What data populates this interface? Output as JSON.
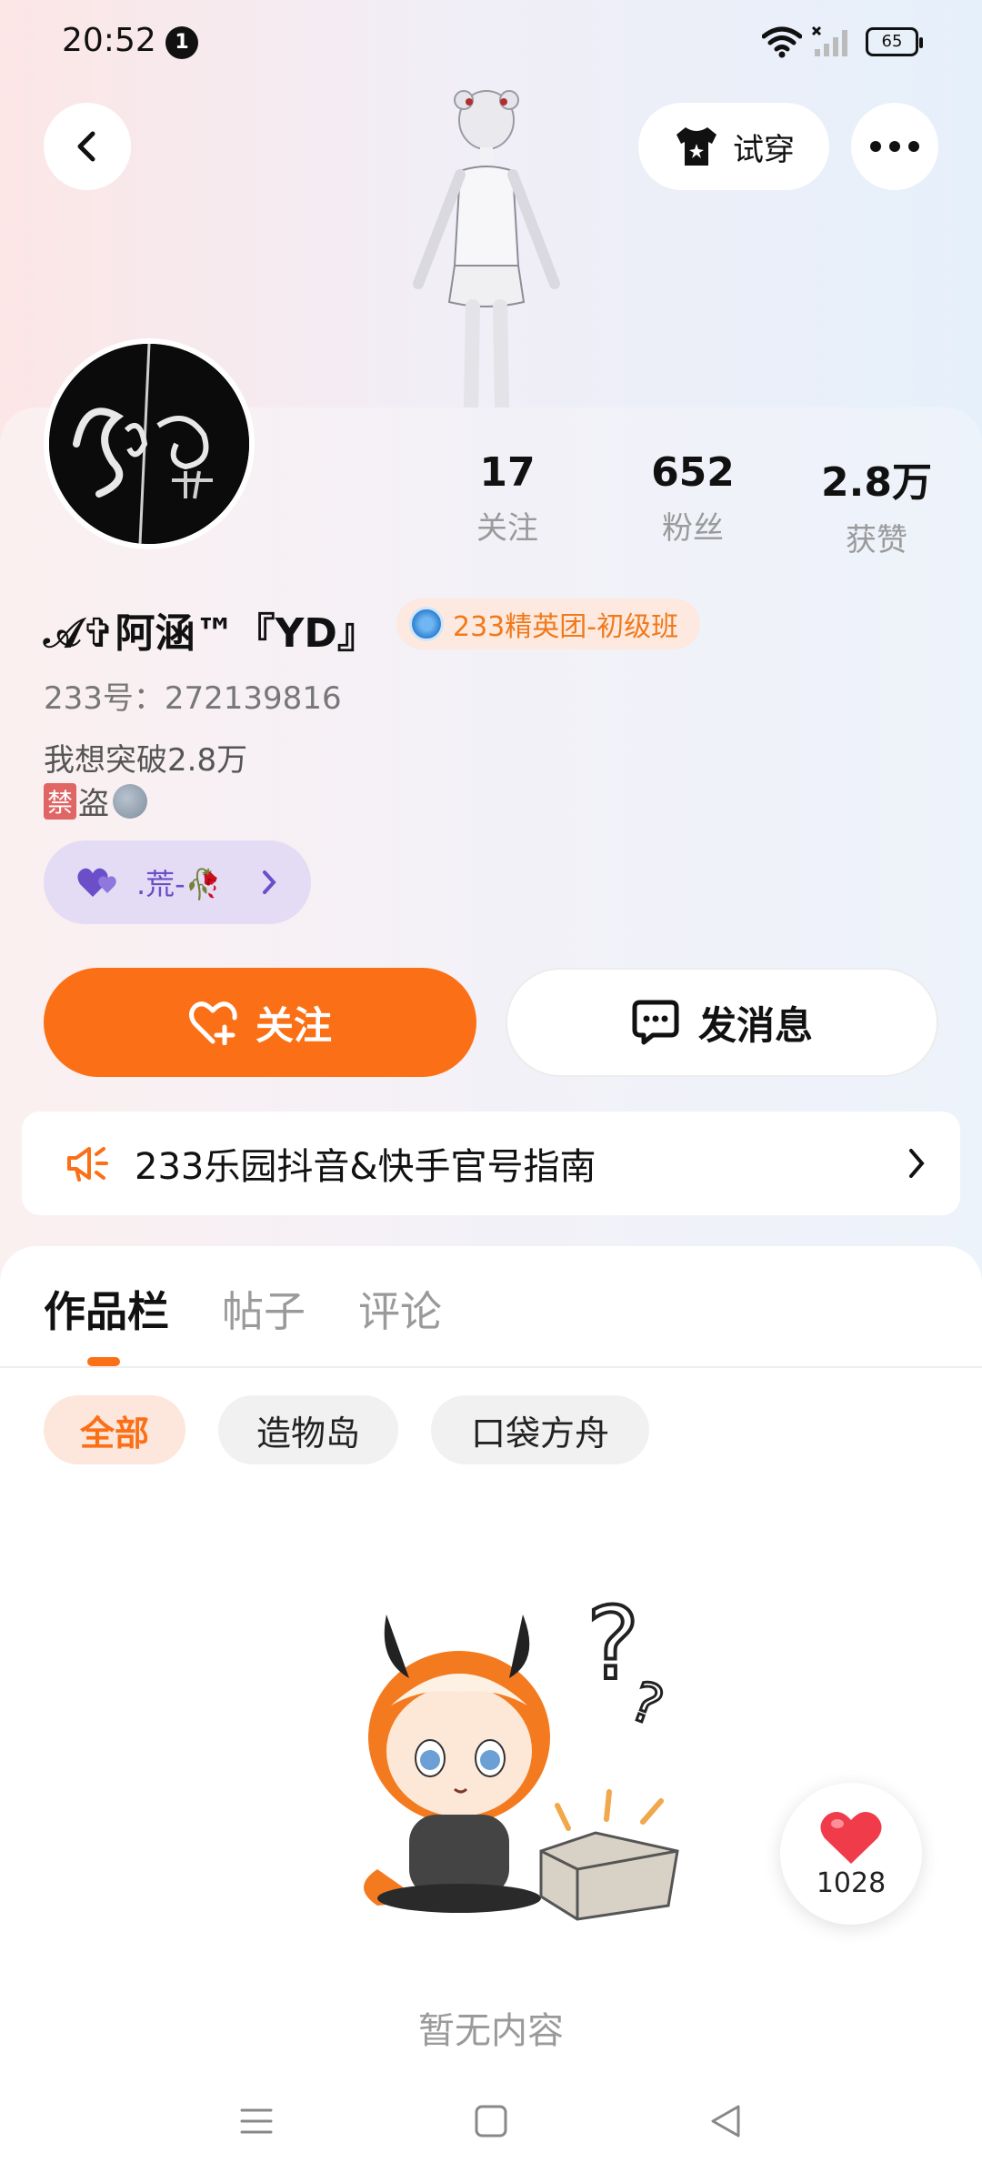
{
  "status_bar": {
    "time": "20:52",
    "notification_count": "1",
    "battery": "65"
  },
  "header": {
    "try_on_label": "试穿"
  },
  "profile": {
    "stats": [
      {
        "value": "17",
        "label": "关注"
      },
      {
        "value": "652",
        "label": "粉丝"
      },
      {
        "value": "2.8万",
        "label": "获赞"
      }
    ],
    "username": "𝒜✞阿涵™『YD』",
    "badge_label": "233精英团-初级班",
    "uid": "233号：272139816",
    "bio_line1": "我想突破2.8万",
    "bio_line2_tag": "禁",
    "bio_line2_text": "盗",
    "group_name": ".荒-🥀",
    "follow_label": "关注",
    "message_label": "发消息",
    "notice_text": "233乐园抖音&快手官号指南"
  },
  "tabs": [
    "作品栏",
    "帖子",
    "评论"
  ],
  "filters": [
    "全部",
    "造物岛",
    "口袋方舟"
  ],
  "empty_text": "暂无内容",
  "like_count": "1028",
  "colors": {
    "accent": "#fb7016",
    "group_purple": "#6a4fc9"
  }
}
